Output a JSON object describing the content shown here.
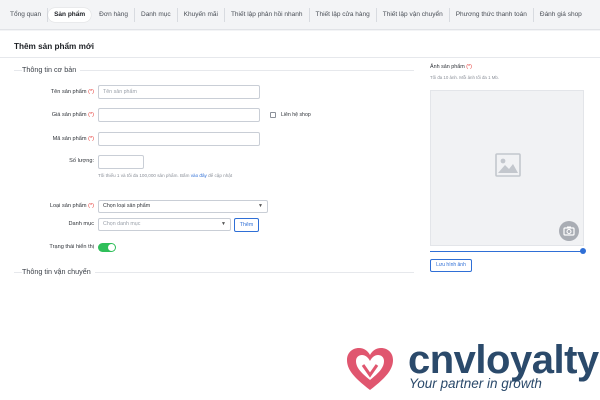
{
  "tabs": [
    {
      "label": "Tổng quan",
      "active": false
    },
    {
      "label": "Sản phẩm",
      "active": true
    },
    {
      "label": "Đơn hàng",
      "active": false
    },
    {
      "label": "Danh mục",
      "active": false
    },
    {
      "label": "Khuyến mãi",
      "active": false
    },
    {
      "label": "Thiết lập phản hồi nhanh",
      "active": false
    },
    {
      "label": "Thiết lập cửa hàng",
      "active": false
    },
    {
      "label": "Thiết lập vận chuyển",
      "active": false
    },
    {
      "label": "Phương thức thanh toán",
      "active": false
    },
    {
      "label": "Đánh giá shop",
      "active": false
    }
  ],
  "page": {
    "title": "Thêm sản phẩm mới"
  },
  "basic_info": {
    "heading": "Thông tin cơ bản",
    "required_mark": "(*)",
    "product_name_label": "Tên sản phẩm",
    "product_name_placeholder": "Tên sản phẩm",
    "price_label": "Giá sản phẩm",
    "contact_shop_label": "Liên hệ shop",
    "contact_shop_checked": false,
    "sku_label": "Mã sản phẩm",
    "quantity_label": "Số lượng:",
    "quantity_hint_before": "Tối thiểu 1 và tối đa 100,000 sản phẩm. Bấm",
    "quantity_hint_link": "vào đây",
    "quantity_hint_after": "để cập nhật",
    "type_label": "Loại sản phẩm",
    "type_value": "Chọn loại sản phẩm",
    "category_label": "Danh mục",
    "category_placeholder": "Chọn danh mục",
    "add_button": "Thêm",
    "display_status_label": "Trạng thái hiển thị",
    "display_status_on": true
  },
  "shipping": {
    "heading": "Thông tin vận chuyển"
  },
  "product_image": {
    "label": "Ảnh sản phẩm",
    "required_mark": "(*)",
    "hint": "Tối đa 10 ảnh. Mỗi ảnh tối đa 1 Mb.",
    "zoom_fraction": 1.0,
    "save_button": "Lưu hình ảnh"
  },
  "logo": {
    "name": "cnvloyalty",
    "tagline": "Your partner in growth"
  },
  "colors": {
    "accent": "#2f6fd6",
    "toggle_on": "#2fbf5a",
    "required": "#e53935",
    "brand_pink": "#e0566f",
    "brand_navy": "#2b4a6b"
  }
}
